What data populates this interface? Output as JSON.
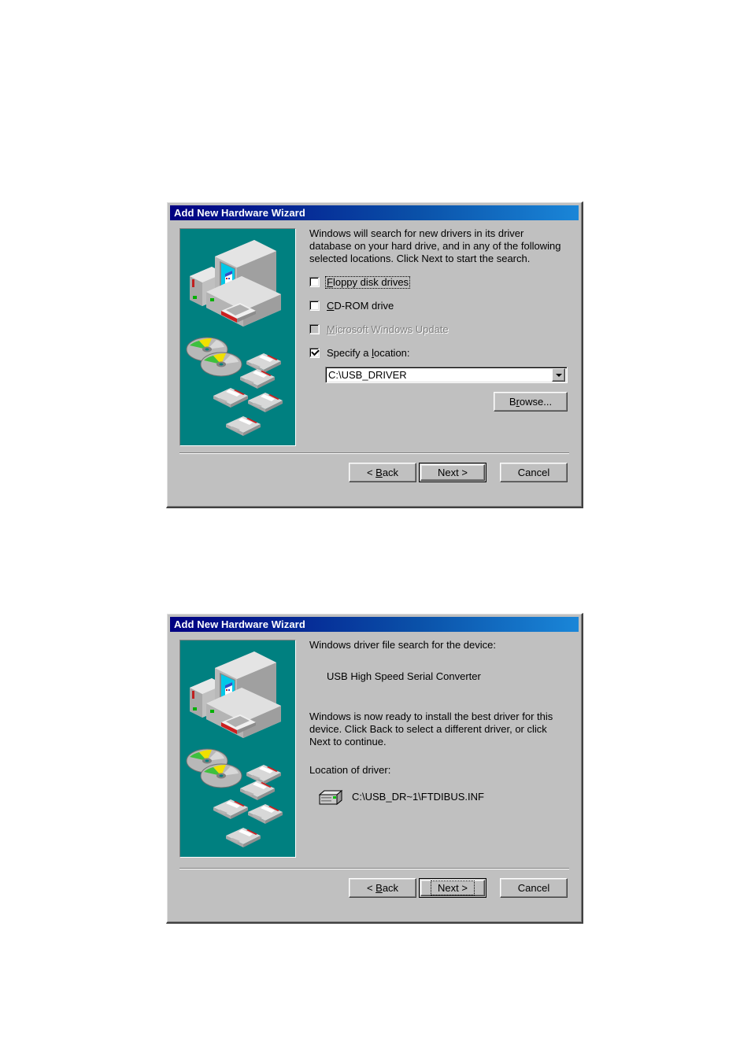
{
  "page": {
    "background": "#ffffff",
    "accent_teal": "#008080",
    "titlebar_gradient_start": "#000082",
    "titlebar_gradient_end": "#1a86d8",
    "dialog_face": "#c0c0c0"
  },
  "dialog_search": {
    "title": "Add New Hardware Wizard",
    "intro": "Windows will search for new drivers in its driver database on your hard drive, and in any of the following selected locations. Click Next to start the search.",
    "options": [
      {
        "label": "Floppy disk drives",
        "accel": "F",
        "checked": false,
        "disabled": false,
        "focused": true
      },
      {
        "label": "CD-ROM drive",
        "accel": "C",
        "checked": false,
        "disabled": false,
        "focused": false
      },
      {
        "label": "Microsoft Windows Update",
        "accel": "M",
        "checked": false,
        "disabled": true,
        "focused": false
      },
      {
        "label": "Specify a location:",
        "accel": "l",
        "checked": true,
        "disabled": false,
        "focused": false
      }
    ],
    "location_combo": {
      "value": "C:\\USB_DRIVER",
      "dropdown_icon": "chevron-down-icon"
    },
    "browse_label": "Browse...",
    "buttons": {
      "back": "< Back",
      "next": "Next >",
      "cancel": "Cancel"
    }
  },
  "dialog_ready": {
    "title": "Add New Hardware Wizard",
    "search_heading": "Windows driver file search for the device:",
    "device_name": "USB High Speed Serial Converter",
    "ready_text": "Windows is now ready to install the best driver for this device. Click Back to select a different driver, or click Next to continue.",
    "location_label": "Location of driver:",
    "driver_path": "C:\\USB_DR~1\\FTDIBUS.INF",
    "driver_icon": "hardware-device-icon",
    "buttons": {
      "back": "< Back",
      "next": "Next >",
      "cancel": "Cancel"
    }
  },
  "illustration": {
    "name": "computer-media-illustration",
    "items": [
      "computer-monitor",
      "computer-tower",
      "compact-discs",
      "floppy-disks"
    ]
  }
}
